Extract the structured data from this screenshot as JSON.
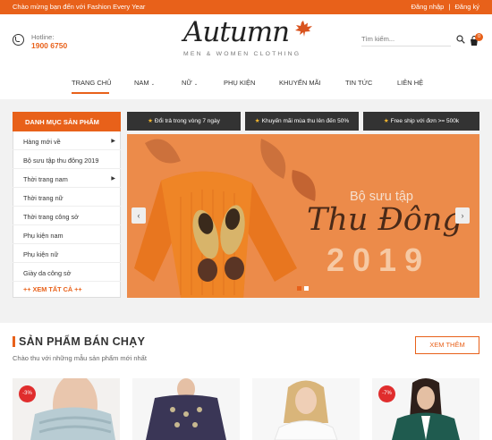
{
  "topbar": {
    "welcome": "Chào mừng bạn đến với Fashion Every Year",
    "login": "Đăng nhập",
    "separator": "|",
    "register": "Đăng ký"
  },
  "header": {
    "hotline_label": "Hotline:",
    "hotline_phone": "1900 6750",
    "logo": "Autumn",
    "tagline": "MEN & WOMEN CLOTHING",
    "search_placeholder": "Tìm kiếm...",
    "cart_count": "0"
  },
  "nav": {
    "items": [
      "TRANG CHỦ",
      "NAM",
      "NỮ",
      "PHỤ KIỆN",
      "KHUYẾN MÃI",
      "TIN TỨC",
      "LIÊN HỆ"
    ]
  },
  "sidebar": {
    "heading": "DANH MỤC SẢN PHẨM",
    "items": [
      "Hàng mới về",
      "Bộ sưu tập thu đông 2019",
      "Thời trang nam",
      "Thời trang nữ",
      "Thời trang công sở",
      "Phụ kiện nam",
      "Phụ kiện nữ",
      "Giày da công sở"
    ],
    "view_all": "++ XEM TẤT CẢ ++"
  },
  "promos": [
    "Đổi trả trong vòng 7 ngày",
    "Khuyến mãi mùa thu lên đến 50%",
    "Free ship với đơn >= 500k"
  ],
  "banner": {
    "subtitle": "Bộ sưu tập",
    "title": "Thu Đông",
    "year": "2019",
    "prev": "‹",
    "next": "›"
  },
  "section": {
    "title": "SẢN PHẨM BÁN CHẠY",
    "subtitle": "Chào thu với những mẫu sản phẩm mới nhất",
    "button": "XEM THÊM"
  },
  "products": [
    {
      "badge": "-3%"
    },
    {
      "badge": ""
    },
    {
      "badge": ""
    },
    {
      "badge": "-7%"
    }
  ],
  "colors": {
    "accent": "#e8611a",
    "banner": "#ec8b4a",
    "dark": "#333333",
    "sale": "#e02d2d"
  }
}
